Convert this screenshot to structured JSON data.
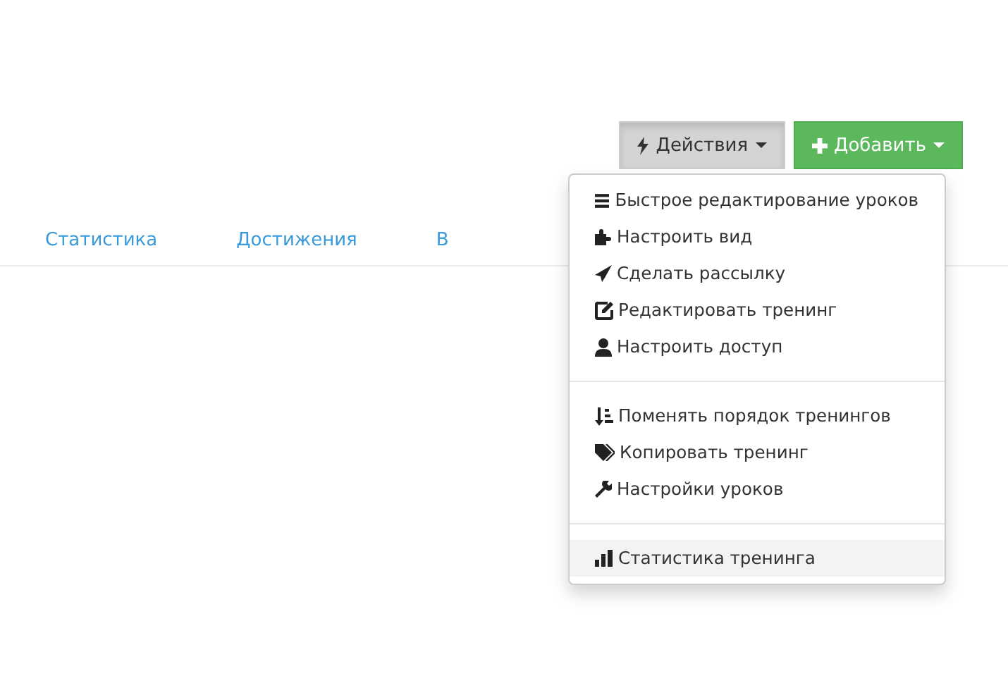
{
  "toolbar": {
    "actions_button": {
      "label": "Действия",
      "expanded": true
    },
    "add_button": {
      "label": "Добавить"
    }
  },
  "tabs": [
    {
      "label": "Статистика"
    },
    {
      "label": "Достижения"
    },
    {
      "label": "В"
    }
  ],
  "menu": {
    "groups": [
      [
        {
          "kind": "list",
          "label": "Быстрое редактирование уроков",
          "selected": false
        },
        {
          "kind": "puzzle",
          "label": "Настроить вид",
          "selected": false
        },
        {
          "kind": "send",
          "label": "Сделать рассылку",
          "selected": false
        },
        {
          "kind": "edit",
          "label": "Редактировать тренинг",
          "selected": false
        },
        {
          "kind": "user",
          "label": "Настроить доступ",
          "selected": false
        }
      ],
      [
        {
          "kind": "sort",
          "label": "Поменять порядок тренингов",
          "selected": false
        },
        {
          "kind": "tags",
          "label": "Копировать тренинг",
          "selected": false
        },
        {
          "kind": "wrench",
          "label": "Настройки уроков",
          "selected": false
        }
      ],
      [
        {
          "kind": "chart",
          "label": "Статистика тренинга",
          "selected": true
        }
      ]
    ]
  }
}
